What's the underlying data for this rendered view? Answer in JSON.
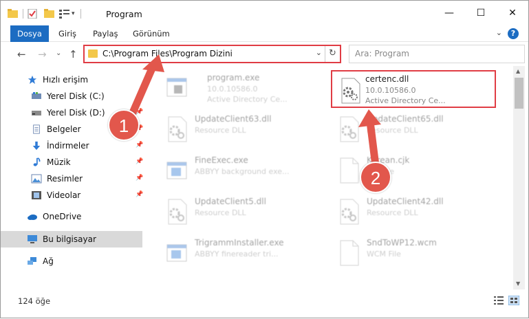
{
  "window": {
    "title": "Program",
    "controls": {
      "minimize": "—",
      "maximize": "☐",
      "close": "✕"
    }
  },
  "ribbon": {
    "tabs": [
      {
        "label": "Dosya"
      },
      {
        "label": "Giriş"
      },
      {
        "label": "Paylaş"
      },
      {
        "label": "Görünüm"
      }
    ],
    "help": "?"
  },
  "nav": {
    "back": "←",
    "forward": "→",
    "recent": "⌄",
    "up": "↑",
    "address": "C:\\Program Files\\Program Dizini",
    "refresh": "↻",
    "search_placeholder": "Ara: Program"
  },
  "sidebar": {
    "items": [
      {
        "label": "Hızlı erişim",
        "icon": "star-icon"
      },
      {
        "label": "Yerel Disk (C:)",
        "icon": "drive-icon"
      },
      {
        "label": "Yerel Disk (D:)",
        "icon": "drive-icon"
      },
      {
        "label": "Belgeler",
        "icon": "documents-icon"
      },
      {
        "label": "İndirmeler",
        "icon": "download-icon"
      },
      {
        "label": "Müzik",
        "icon": "music-icon"
      },
      {
        "label": "Resimler",
        "icon": "pictures-icon"
      },
      {
        "label": "Videolar",
        "icon": "video-icon"
      },
      {
        "label": "OneDrive",
        "icon": "cloud-icon"
      },
      {
        "label": "Bu bilgisayar",
        "icon": "computer-icon"
      },
      {
        "label": "Ağ",
        "icon": "network-icon"
      }
    ]
  },
  "files": [
    {
      "name": "program.exe",
      "line1": "10.0.10586.0",
      "line2": "Active Directory Ce...",
      "icon": "exe-icon"
    },
    {
      "name": "certenc.dll",
      "line1": "10.0.10586.0",
      "line2": "Active Directory Ce...",
      "icon": "dll-gear-icon"
    },
    {
      "name": "UpdateClient63.dll",
      "line1": "Resource DLL",
      "line2": "",
      "icon": "dll-gear-icon"
    },
    {
      "name": "UpdateClient65.dll",
      "line1": "Resource DLL",
      "line2": "",
      "icon": "dll-gear-icon"
    },
    {
      "name": "FineExec.exe",
      "line1": "ABBYY background exe...",
      "line2": "",
      "icon": "exe-icon"
    },
    {
      "name": "Korean.cjk",
      "line1": "CJK File",
      "line2": "",
      "icon": "file-icon"
    },
    {
      "name": "UpdateClient5.dll",
      "line1": "Resource DLL",
      "line2": "",
      "icon": "dll-gear-icon"
    },
    {
      "name": "UpdateClient42.dll",
      "line1": "Resource DLL",
      "line2": "",
      "icon": "dll-gear-icon"
    },
    {
      "name": "TrigrammInstaller.exe",
      "line1": "ABBYY finereader tri...",
      "line2": "",
      "icon": "exe-icon"
    },
    {
      "name": "SndToWP12.wcm",
      "line1": "WCM File",
      "line2": "",
      "icon": "file-icon"
    }
  ],
  "status": {
    "count": "124 öğe"
  },
  "annotations": {
    "badge1": "1",
    "badge2": "2"
  },
  "colors": {
    "accent": "#1c6cc2",
    "highlight": "#e03c44",
    "badge": "#e2574c"
  }
}
